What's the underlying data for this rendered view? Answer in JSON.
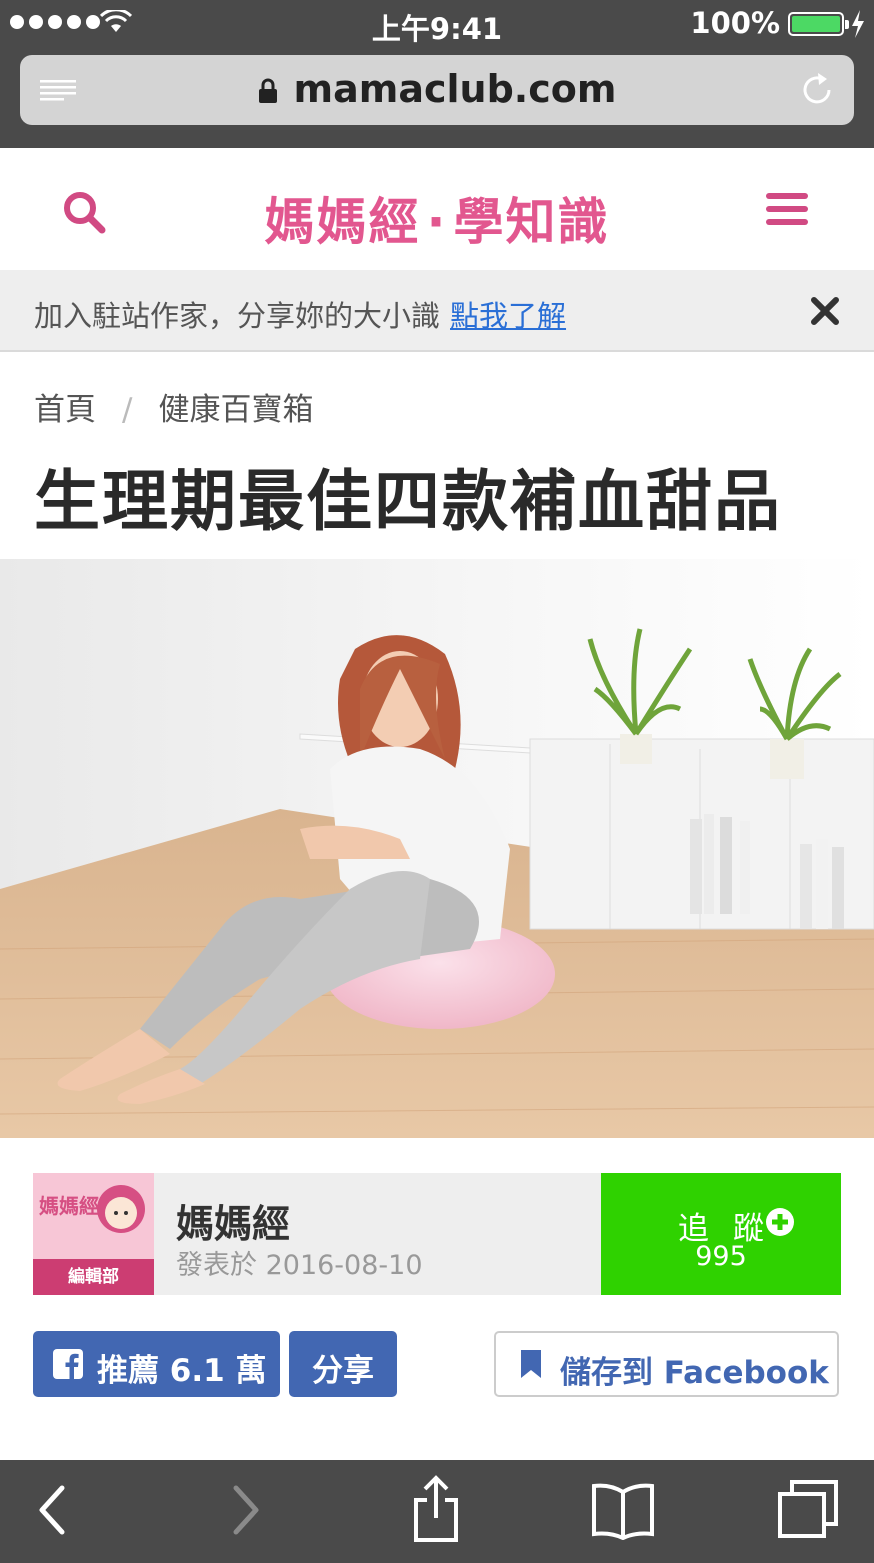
{
  "status_bar": {
    "time": "上午9:41",
    "battery_percent": "100%",
    "battery_level": 1.0,
    "battery_color": "#4cd964"
  },
  "browser": {
    "url": "mamaclub.com",
    "icons": [
      "reader-icon",
      "lock-icon",
      "reload-icon"
    ]
  },
  "site_header": {
    "logo_main": "媽媽經",
    "logo_dot": "·",
    "logo_sub": "學知識",
    "brand_color": "#e2578f"
  },
  "notice": {
    "text": "加入駐站作家，分享妳的大小識",
    "link": "點我了解"
  },
  "breadcrumb": {
    "home": "首頁",
    "separator": "/",
    "category": "健康百寶箱"
  },
  "article": {
    "title": "生理期最佳四款補血甜品"
  },
  "author": {
    "avatar_text": "媽媽經",
    "avatar_tag": "編輯部",
    "name": "媽媽經",
    "published": "發表於 2016-08-10",
    "follow_label": "追蹤",
    "follow_count": "995",
    "follow_color": "#2fd200"
  },
  "social": {
    "like_label": "推薦 6.1 萬",
    "share_label": "分享",
    "save_label": "儲存到 Facebook",
    "facebook_color": "#4267b2"
  },
  "toolbar": {
    "icons": [
      "back-icon",
      "forward-icon",
      "share-icon",
      "bookmarks-icon",
      "tabs-icon"
    ]
  }
}
